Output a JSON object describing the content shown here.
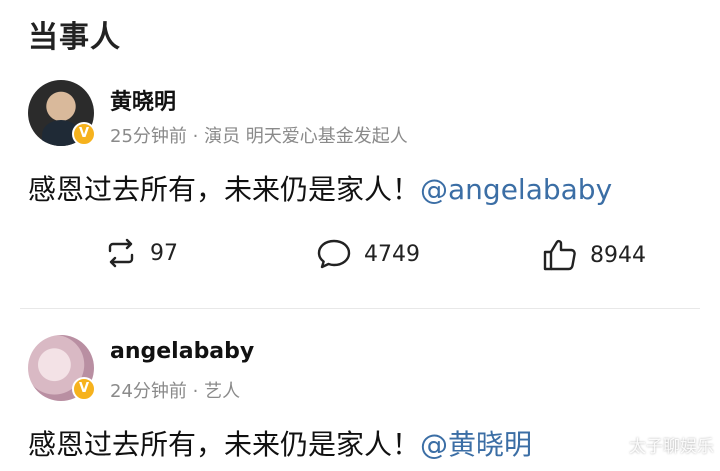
{
  "section": {
    "title": "当事人"
  },
  "posts": [
    {
      "username": "黄晓明",
      "meta": "25分钟前 · 演员 明天爱心基金发起人",
      "text": "感恩过去所有，未来仍是家人！",
      "mention": "@angelababy",
      "verified_symbol": "V",
      "actions": {
        "reposts": "97",
        "comments": "4749",
        "likes": "8944"
      }
    },
    {
      "username": "angelababy",
      "meta": "24分钟前 · 艺人",
      "text": "感恩过去所有，未来仍是家人！",
      "mention": "@黄晓明",
      "verified_symbol": "V"
    }
  ],
  "watermark": "太子聊娱乐",
  "colors": {
    "mention": "#3b6ea5",
    "meta": "#8a8a8a",
    "verified": "#f6b21d"
  }
}
